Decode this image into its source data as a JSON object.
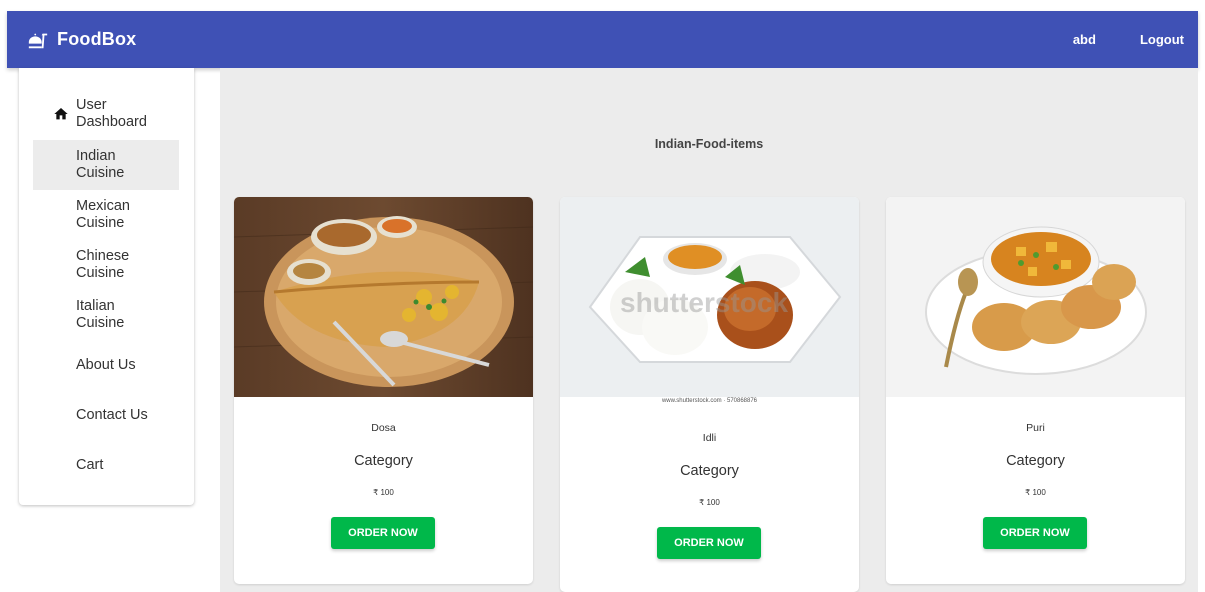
{
  "appbar": {
    "brand": "FoodBox",
    "user": "abd",
    "logout": "Logout",
    "color": "#3f51b5"
  },
  "sidebar": {
    "items": [
      {
        "label": "User\nDashboard",
        "icon": "home-icon"
      },
      {
        "label": "Indian\nCuisine",
        "selected": true
      },
      {
        "label": "Mexican\nCuisine"
      },
      {
        "label": "Chinese\nCuisine"
      },
      {
        "label": "Italian\nCuisine"
      },
      {
        "label": "About Us"
      },
      {
        "label": "Contact Us"
      },
      {
        "label": "Cart"
      }
    ]
  },
  "main": {
    "title": "Indian-Food-items",
    "cards": [
      {
        "name": "Dosa",
        "category": "Category",
        "price": "₹ 100",
        "button": "ORDER NOW"
      },
      {
        "name": "Idli",
        "category": "Category",
        "price": "₹ 100",
        "button": "ORDER NOW",
        "caption": "www.shutterstock.com · 570868876",
        "watermark": "shutterstock"
      },
      {
        "name": "Puri",
        "category": "Category",
        "price": "₹ 100",
        "button": "ORDER NOW"
      }
    ],
    "button_color": "#00b84a"
  }
}
